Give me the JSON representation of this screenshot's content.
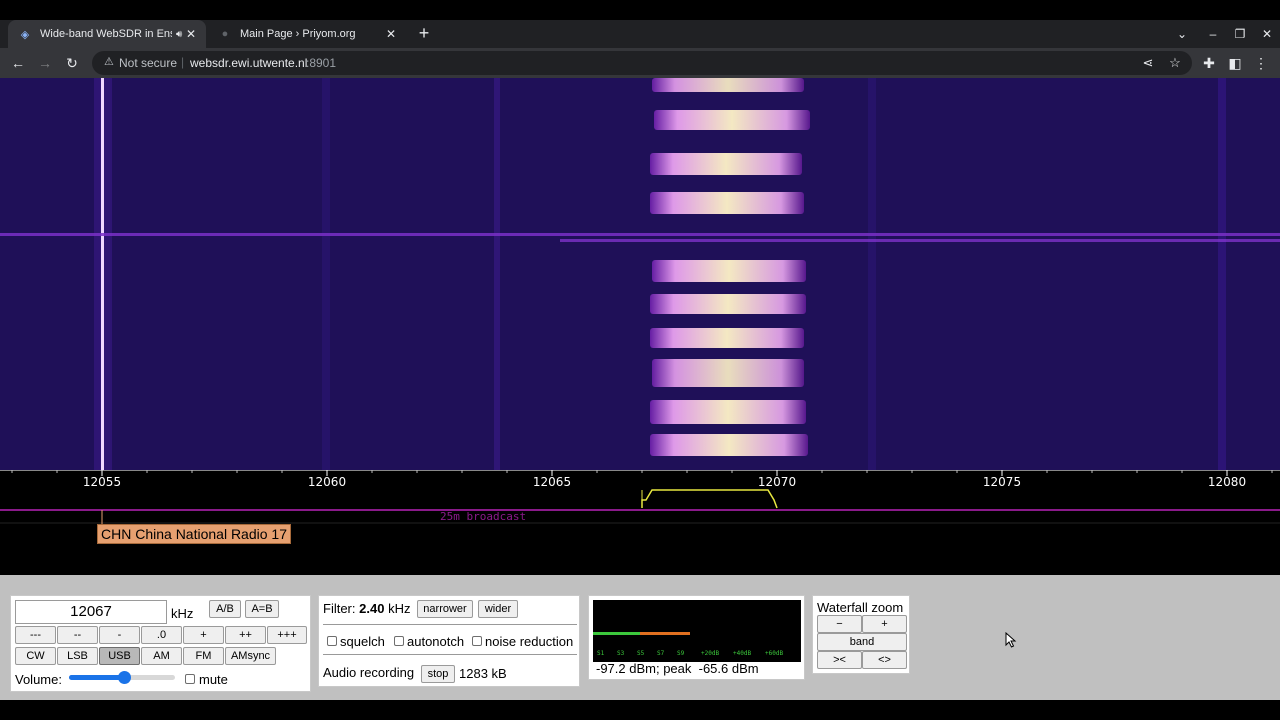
{
  "browser": {
    "tabs": [
      {
        "title": "Wide-band WebSDR in Ensc",
        "active": true,
        "audio": true
      },
      {
        "title": "Main Page › Priyom.org",
        "active": false,
        "audio": false
      }
    ],
    "address": {
      "security": "Not secure",
      "host": "websdr.ewi.utwente.nl",
      "port": ":8901"
    }
  },
  "scale": {
    "ticks": [
      "12055",
      "12060",
      "12065",
      "12070",
      "12075",
      "12080"
    ],
    "band_label": "25m broadcast",
    "station_label": "CHN China National Radio 17"
  },
  "frequency_panel": {
    "frequency": "12067",
    "unit": "kHz",
    "ab_label": "A/B",
    "aeqb_label": "A=B",
    "step_buttons": [
      "---",
      "--",
      "-",
      ".0",
      "+",
      "++",
      "+++"
    ],
    "modes": [
      "CW",
      "LSB",
      "USB",
      "AM",
      "FM",
      "AMsync"
    ],
    "selected_mode": "USB",
    "volume_label": "Volume:",
    "volume_level": 0.52,
    "mute_label": "mute",
    "mute_checked": false
  },
  "filter_panel": {
    "filter_label": "Filter:",
    "bandwidth": "2.40",
    "bandwidth_unit": "kHz",
    "narrower_label": "narrower",
    "wider_label": "wider",
    "squelch_label": "squelch",
    "autonotch_label": "autonotch",
    "noise_reduction_label": "noise reduction",
    "audio_recording_label": "Audio recording",
    "stop_label": "stop",
    "recording_size": "1283 kB"
  },
  "smeter_panel": {
    "scale_labels": [
      "S1",
      "S3",
      "S5",
      "S7",
      "S9",
      "+20dB",
      "+40dB",
      "+60dB"
    ],
    "level": -97.2,
    "peak": -65.6,
    "readout": "-97.2 dBm; peak  -65.6 dBm",
    "colors": {
      "signal": "#3cc83c",
      "peak": "#e07020"
    }
  },
  "zoom_panel": {
    "title": "Waterfall zoom",
    "zoom_out_label": "−",
    "zoom_in_label": "+",
    "band_label": "band",
    "narrow_label": "><",
    "wide_label": "<>"
  }
}
